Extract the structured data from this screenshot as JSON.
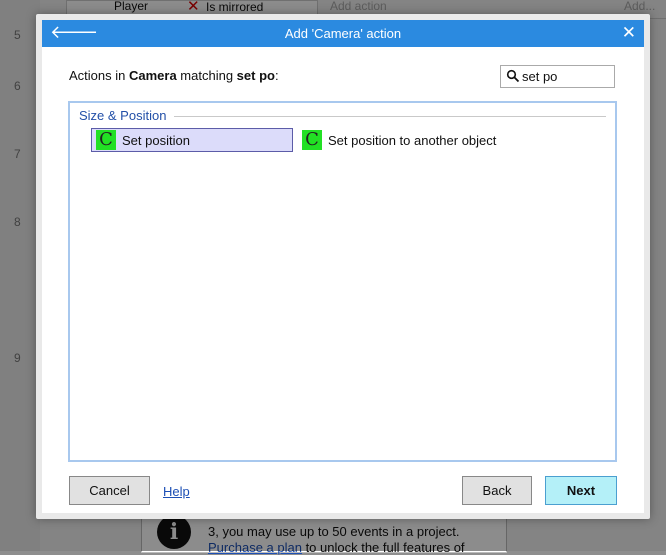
{
  "background": {
    "row_numbers": [
      "5",
      "6",
      "7",
      "8",
      "9"
    ],
    "condition_object": "Player",
    "condition_text": "Is mirrored",
    "add_action": "Add action",
    "add_ellipsis": "Add...",
    "info_line1": "3, you may use up to 50 events in a project.",
    "info_link": "Purchase a plan",
    "info_line2_rest": " to unlock the full features of"
  },
  "dialog": {
    "title": "Add 'Camera' action",
    "matching": {
      "prefix": "Actions in ",
      "object": "Camera",
      "middle": " matching ",
      "query": "set po",
      "suffix": ":"
    },
    "search": {
      "value": "set po"
    },
    "category": "Size & Position",
    "actions": [
      {
        "label": "Set position",
        "selected": true,
        "icon": "C"
      },
      {
        "label": "Set position to another object",
        "selected": false,
        "icon": "C"
      }
    ],
    "buttons": {
      "cancel": "Cancel",
      "help": "Help",
      "back": "Back",
      "next": "Next"
    }
  },
  "colors": {
    "titlebar": "#2b8ae0",
    "selection": "#dcdcfa",
    "next_button": "#b4f0f8",
    "icon_green": "#22e024"
  },
  "icons": {
    "back": "back-arrow-icon",
    "close": "close-icon",
    "search": "search-icon",
    "info": "info-icon",
    "camera_action": "camera-c-icon"
  }
}
